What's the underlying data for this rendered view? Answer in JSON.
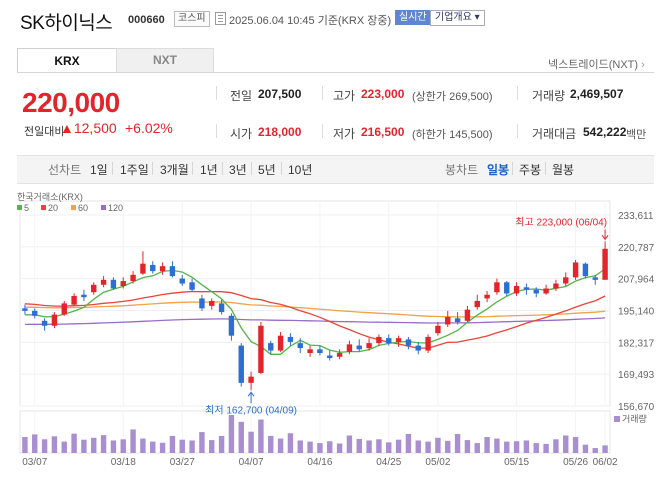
{
  "header": {
    "name": "SK하이닉스",
    "code": "000660",
    "market": "코스피",
    "datetime": "2025.06.04 10:45  기준(KRX 장중)",
    "realtime": "실시간",
    "overview": "기업개요 ▾"
  },
  "tabs": {
    "krx": "KRX",
    "nxt": "NXT",
    "nxt_link": "넥스트레이드(NXT)"
  },
  "price": {
    "current": "220,000",
    "change_label": "전일대비",
    "change_amount": "▲12,500",
    "change_percent": "+6.02%"
  },
  "stats": {
    "prev_label": "전일",
    "prev": "207,500",
    "high_label": "고가",
    "high": "223,000",
    "upper_limit": "(상한가 269,500)",
    "volume_label": "거래량",
    "volume": "2,469,507",
    "open_label": "시가",
    "open": "218,000",
    "low_label": "저가",
    "low": "216,500",
    "lower_limit": "(하한가 145,500)",
    "amount_label": "거래대금",
    "amount": "542,222",
    "amount_unit": "백만"
  },
  "period": {
    "label": "선차트",
    "items": [
      "1일",
      "1주일",
      "3개월",
      "1년",
      "3년",
      "5년",
      "10년"
    ],
    "candle_label": "봉차트",
    "candle_items": [
      "일봉",
      "주봉",
      "월봉"
    ],
    "candle_active": "일봉"
  },
  "chart_data": {
    "type": "candlestick",
    "source_label": "한국거래소(KRX)",
    "legend": [
      {
        "name": "5",
        "color": "#55b44a"
      },
      {
        "name": "20",
        "color": "#e6453a"
      },
      {
        "name": "60",
        "color": "#f0a34a"
      },
      {
        "name": "120",
        "color": "#9b6cc6"
      }
    ],
    "ylim": [
      156670,
      233611
    ],
    "y_ticks": [
      "233,611",
      "220,787",
      "207,964",
      "195,140",
      "182,317",
      "169,493",
      "156,670"
    ],
    "x_labels": [
      "03/07",
      "03/18",
      "03/27",
      "04/07",
      "04/16",
      "04/25",
      "05/02",
      "05/15",
      "05/26",
      "06/02"
    ],
    "max_annotation": "최고 223,000 (06/04)",
    "min_annotation": "최저 162,700 (04/09)",
    "volume_legend": "거래량",
    "up_color": "#e3252b",
    "down_color": "#2c6fd1",
    "candles": [
      [
        196000,
        195000,
        197500,
        193500
      ],
      [
        195000,
        193000,
        196000,
        192000
      ],
      [
        191000,
        189000,
        192000,
        187000
      ],
      [
        189000,
        193500,
        194500,
        188000
      ],
      [
        193500,
        198000,
        199000,
        193000
      ],
      [
        197500,
        201000,
        202000,
        197000
      ],
      [
        201500,
        200500,
        203500,
        199000
      ],
      [
        202500,
        205500,
        206500,
        201500
      ],
      [
        205500,
        207500,
        209000,
        204500
      ],
      [
        207500,
        204000,
        208500,
        203500
      ],
      [
        205000,
        207000,
        208500,
        204000
      ],
      [
        207000,
        209500,
        211000,
        206000
      ],
      [
        210000,
        214000,
        219000,
        209500
      ],
      [
        213500,
        211000,
        215000,
        210000
      ],
      [
        211000,
        213000,
        214500,
        209500
      ],
      [
        213000,
        209000,
        215000,
        208500
      ],
      [
        208000,
        206000,
        209500,
        205000
      ],
      [
        206500,
        203500,
        208000,
        203000
      ],
      [
        200000,
        196000,
        201500,
        195000
      ],
      [
        197000,
        199000,
        200000,
        195500
      ],
      [
        198000,
        194500,
        199500,
        193500
      ],
      [
        193000,
        185000,
        194000,
        183000
      ],
      [
        181000,
        166000,
        182000,
        164500
      ],
      [
        166000,
        168500,
        170500,
        163000
      ],
      [
        170000,
        189000,
        190500,
        169500
      ],
      [
        182000,
        179000,
        183000,
        177500
      ],
      [
        179000,
        185000,
        186500,
        178500
      ],
      [
        184500,
        182500,
        186000,
        181000
      ],
      [
        182000,
        180000,
        184000,
        178000
      ],
      [
        178000,
        179500,
        181000,
        176500
      ],
      [
        179500,
        178000,
        181000,
        177000
      ],
      [
        177000,
        176000,
        179000,
        175000
      ],
      [
        176500,
        178000,
        179500,
        175500
      ],
      [
        178500,
        181500,
        183000,
        177500
      ],
      [
        181000,
        179500,
        183500,
        178500
      ],
      [
        180000,
        182000,
        184000,
        179000
      ],
      [
        182000,
        184500,
        185500,
        181000
      ],
      [
        184000,
        182000,
        185500,
        181000
      ],
      [
        182500,
        184000,
        185000,
        180500
      ],
      [
        183500,
        181000,
        184500,
        179500
      ],
      [
        181000,
        179000,
        182500,
        177500
      ],
      [
        179000,
        184500,
        185500,
        178000
      ],
      [
        186000,
        189000,
        190500,
        185000
      ],
      [
        189500,
        192500,
        195000,
        188500
      ],
      [
        192000,
        190500,
        194500,
        189500
      ],
      [
        191000,
        195500,
        197000,
        190500
      ],
      [
        196500,
        199000,
        201500,
        195500
      ],
      [
        200000,
        201500,
        203000,
        198500
      ],
      [
        202500,
        206500,
        208000,
        201500
      ],
      [
        206500,
        202000,
        207000,
        201000
      ],
      [
        202000,
        205000,
        206500,
        201000
      ],
      [
        204500,
        203500,
        206000,
        201500
      ],
      [
        203500,
        202000,
        204500,
        200500
      ],
      [
        202000,
        204000,
        205500,
        201500
      ],
      [
        204000,
        206000,
        207500,
        203000
      ],
      [
        206000,
        208500,
        210500,
        205000
      ],
      [
        208500,
        214500,
        215500,
        207500
      ],
      [
        214000,
        209000,
        214500,
        208000
      ],
      [
        208500,
        207500,
        209500,
        205500
      ],
      [
        207500,
        220000,
        223000,
        216500
      ]
    ],
    "volumes": [
      0.42,
      0.49,
      0.36,
      0.44,
      0.3,
      0.51,
      0.35,
      0.4,
      0.47,
      0.33,
      0.36,
      0.62,
      0.38,
      0.3,
      0.27,
      0.45,
      0.35,
      0.33,
      0.55,
      0.34,
      0.45,
      1.0,
      0.82,
      0.56,
      0.88,
      0.45,
      0.38,
      0.52,
      0.33,
      0.3,
      0.26,
      0.31,
      0.25,
      0.46,
      0.37,
      0.33,
      0.36,
      0.28,
      0.35,
      0.5,
      0.33,
      0.3,
      0.4,
      0.32,
      0.5,
      0.34,
      0.26,
      0.42,
      0.38,
      0.3,
      0.31,
      0.33,
      0.26,
      0.24,
      0.36,
      0.46,
      0.42,
      0.22,
      0.13,
      0.2
    ]
  }
}
